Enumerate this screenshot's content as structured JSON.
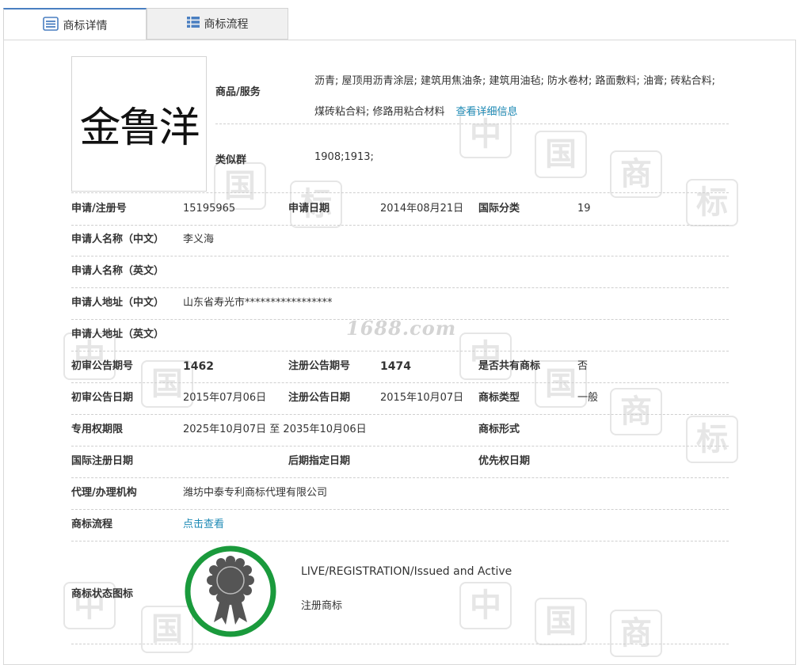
{
  "tabs": [
    {
      "label": "商标详情",
      "icon": "details-icon"
    },
    {
      "label": "商标流程",
      "icon": "list-icon"
    }
  ],
  "logo": {
    "text": "金鲁洋"
  },
  "goods": {
    "label": "商品/服务",
    "value": "沥青; 屋顶用沥青涂层; 建筑用焦油条; 建筑用油毡; 防水卷材; 路面敷料; 油膏; 砖粘合料; 煤砖粘合料; 修路用粘合材料",
    "link": "查看详细信息"
  },
  "similar": {
    "label": "类似群",
    "value": "1908;1913;"
  },
  "rows": {
    "reg_no": {
      "label": "申请/注册号",
      "value": "15195965"
    },
    "app_date": {
      "label": "申请日期",
      "value": "2014年08月21日"
    },
    "intl_class": {
      "label": "国际分类",
      "value": "19"
    },
    "applicant_cn": {
      "label": "申请人名称（中文）",
      "value": "李义海"
    },
    "applicant_en": {
      "label": "申请人名称（英文）",
      "value": ""
    },
    "address_cn": {
      "label": "申请人地址（中文）",
      "value": "山东省寿光市*****************"
    },
    "address_en": {
      "label": "申请人地址（英文）",
      "value": ""
    },
    "prelim_issue": {
      "label": "初审公告期号",
      "value": "1462"
    },
    "reg_issue": {
      "label": "注册公告期号",
      "value": "1474"
    },
    "shared": {
      "label": "是否共有商标",
      "value": "否"
    },
    "prelim_date": {
      "label": "初审公告日期",
      "value": "2015年07月06日"
    },
    "reg_date": {
      "label": "注册公告日期",
      "value": "2015年10月07日"
    },
    "tm_type": {
      "label": "商标类型",
      "value": "一般"
    },
    "exclusive": {
      "label": "专用权期限",
      "value": "2025年10月07日 至 2035年10月06日"
    },
    "tm_form": {
      "label": "商标形式",
      "value": ""
    },
    "intl_reg_date": {
      "label": "国际注册日期",
      "value": ""
    },
    "later_date": {
      "label": "后期指定日期",
      "value": ""
    },
    "priority_date": {
      "label": "优先权日期",
      "value": ""
    },
    "agent": {
      "label": "代理/办理机构",
      "value": "潍坊中泰专利商标代理有限公司"
    },
    "flow": {
      "label": "商标流程",
      "value": "点击查看"
    }
  },
  "status": {
    "label": "商标状态图标",
    "en": "LIVE/REGISTRATION/Issued and Active",
    "cn": "注册商标"
  },
  "watermark": {
    "site": "1688.com",
    "chars": [
      "中",
      "国",
      "商",
      "标"
    ]
  },
  "colors": {
    "link": "#1e8ab5",
    "tab_accent": "#4a7fc1",
    "badge_ring": "#1a9a3c",
    "badge_icon": "#555555"
  }
}
